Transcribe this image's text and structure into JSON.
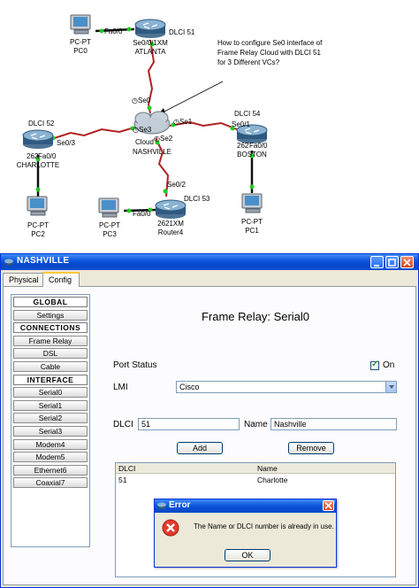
{
  "topology": {
    "devices": {
      "pc0": {
        "type": "PC-PT",
        "name": "PC0"
      },
      "atlanta": {
        "model": "Se0/0/1XM",
        "name": "ATLANTA",
        "dlci": "DLCI 51"
      },
      "cloud": {
        "name": "Cloud",
        "sub": "NASHVILLE"
      },
      "charlotte": {
        "model": "262",
        "name": "CHARLOTTE",
        "dlci": "DLCI 52"
      },
      "boston": {
        "model": "262",
        "name": "BOSTON",
        "dlci": "DLCI 54"
      },
      "router4": {
        "model": "2621XM",
        "name": "Router4",
        "dlci": "DLCI 53"
      },
      "pc2": {
        "type": "PC-PT",
        "name": "PC2"
      },
      "pc3": {
        "type": "PC-PT",
        "name": "PC3"
      },
      "pc1": {
        "type": "PC-PT",
        "name": "PC1"
      }
    },
    "ports": {
      "pc0_fa": "Fa0/0",
      "cloud_se0": "Se0",
      "cloud_se1": "Se1",
      "cloud_se2": "Se2",
      "cloud_se3": "Se3",
      "charlotte_se": "Se0/3",
      "charlotte_fa": "Fa0/0",
      "boston_se": "Se0/1",
      "boston_fa": "Fa0/0",
      "router4_se": "Se0/2",
      "router4_fa": "Fa0/0"
    },
    "annotation": [
      "How to configure Se0 interface of",
      "Frame Relay Cloud with DLCI 51",
      "for 3 Different VCs?"
    ],
    "colors": {
      "serial_link": "#b22222",
      "ethernet_link": "#111111",
      "link_up": "#22cc22"
    }
  },
  "window": {
    "title": "NASHVILLE",
    "tabs": [
      "Physical",
      "Config"
    ],
    "active_tab": "Config",
    "sidebar": [
      {
        "label": "GLOBAL",
        "header": true
      },
      {
        "label": "Settings"
      },
      {
        "label": "CONNECTIONS",
        "header": true
      },
      {
        "label": "Frame Relay"
      },
      {
        "label": "DSL"
      },
      {
        "label": "Cable"
      },
      {
        "label": "INTERFACE",
        "header": true
      },
      {
        "label": "Serial0"
      },
      {
        "label": "Serial1"
      },
      {
        "label": "Serial2"
      },
      {
        "label": "Serial3"
      },
      {
        "label": "Modem4"
      },
      {
        "label": "Modem5"
      },
      {
        "label": "Ethernet6"
      },
      {
        "label": "Coaxial7"
      }
    ],
    "config": {
      "title": "Frame Relay: Serial0",
      "port_status_label": "Port Status",
      "on_label": "On",
      "lmi_label": "LMI",
      "lmi_value": "Cisco",
      "dlci_label": "DLCI",
      "dlci_value": "51",
      "name_label": "Name",
      "name_value": "Nashville",
      "add_label": "Add",
      "remove_label": "Remove",
      "table": {
        "headers": [
          "DLCI",
          "Name"
        ],
        "rows": [
          [
            "51",
            "Charlotte"
          ]
        ]
      }
    },
    "error": {
      "title": "Error",
      "message": "The Name or DLCI number is already in use.",
      "ok_label": "OK"
    }
  }
}
